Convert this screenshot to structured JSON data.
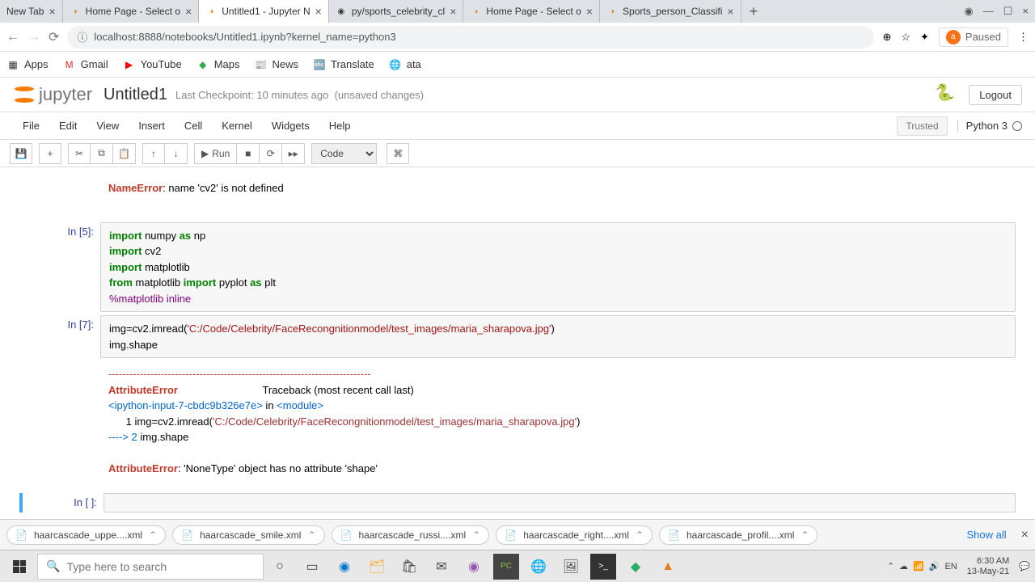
{
  "browser": {
    "tabs": [
      {
        "label": "New Tab",
        "icon": ""
      },
      {
        "label": "Home Page - Select o",
        "icon": "◑"
      },
      {
        "label": "Untitled1 - Jupyter N",
        "icon": "◑",
        "active": true
      },
      {
        "label": "py/sports_celebrity_cl",
        "icon": "◉"
      },
      {
        "label": "Home Page - Select o",
        "icon": "◑"
      },
      {
        "label": "Sports_person_Classifi",
        "icon": "◑"
      }
    ],
    "url": "localhost:8888/notebooks/Untitled1.ipynb?kernel_name=python3",
    "paused": "Paused",
    "bookmarks": [
      {
        "label": "Apps",
        "icon": "▦"
      },
      {
        "label": "Gmail",
        "icon": "M"
      },
      {
        "label": "YouTube",
        "icon": "▶"
      },
      {
        "label": "Maps",
        "icon": "◆"
      },
      {
        "label": "News",
        "icon": "📰"
      },
      {
        "label": "Translate",
        "icon": "🔤"
      },
      {
        "label": "ata",
        "icon": "🌐"
      }
    ]
  },
  "jupyter": {
    "logo_text": "jupyter",
    "title": "Untitled1",
    "checkpoint": "Last Checkpoint: 10 minutes ago",
    "unsaved": "(unsaved changes)",
    "logout": "Logout",
    "menu": [
      "File",
      "Edit",
      "View",
      "Insert",
      "Cell",
      "Kernel",
      "Widgets",
      "Help"
    ],
    "trusted": "Trusted",
    "kernel": "Python 3",
    "run_label": "Run",
    "cell_type": "Code"
  },
  "cells": {
    "err1_name": "NameError",
    "err1_msg": ": name 'cv2' is not defined",
    "p5": "In [5]:",
    "c5_l1a": "import",
    "c5_l1b": " numpy ",
    "c5_l1c": "as",
    "c5_l1d": " np",
    "c5_l2a": "import",
    "c5_l2b": " cv2",
    "c5_l3a": "import",
    "c5_l3b": " matplotlib",
    "c5_l4a": "from",
    "c5_l4b": " matplotlib ",
    "c5_l4c": "import",
    "c5_l4d": " pyplot ",
    "c5_l4e": "as",
    "c5_l4f": " plt",
    "c5_l5": "%matplotlib inline",
    "p7": "In [7]:",
    "c7_l1a": "img=cv2.imread(",
    "c7_l1b": "'C:/Code/Celebrity/FaceRecongnitionmodel/test_images/maria_sharapova.jpg'",
    "c7_l1c": ")",
    "c7_l2": "img.shape",
    "tb_sep": "---------------------------------------------------------------------------",
    "tb_name": "AttributeError",
    "tb_trace": "                             Traceback (most recent call last)",
    "tb_ipy": "<ipython-input-7-cbdc9b326e7e>",
    "tb_in": " in ",
    "tb_mod": "<module>",
    "tb_l1a": "      1 ",
    "tb_l1b": "img=cv2.imread(",
    "tb_l1c": "'C:/Code/Celebrity/FaceRecongnitionmodel/test_images/maria_sharapova.jpg'",
    "tb_l1d": ")",
    "tb_l2a": "----> 2 ",
    "tb_l2b": "img.shape",
    "tb_final_name": "AttributeError",
    "tb_final_msg": ": 'NoneType' object has no attribute 'shape'",
    "p_empty": "In [ ]:"
  },
  "downloads": {
    "items": [
      "haarcascade_uppe....xml",
      "haarcascade_smile.xml",
      "haarcascade_russi....xml",
      "haarcascade_right....xml",
      "haarcascade_profil....xml"
    ],
    "show_all": "Show all"
  },
  "taskbar": {
    "search_placeholder": "Type here to search",
    "time": "6:30 AM",
    "date": "13-May-21"
  }
}
